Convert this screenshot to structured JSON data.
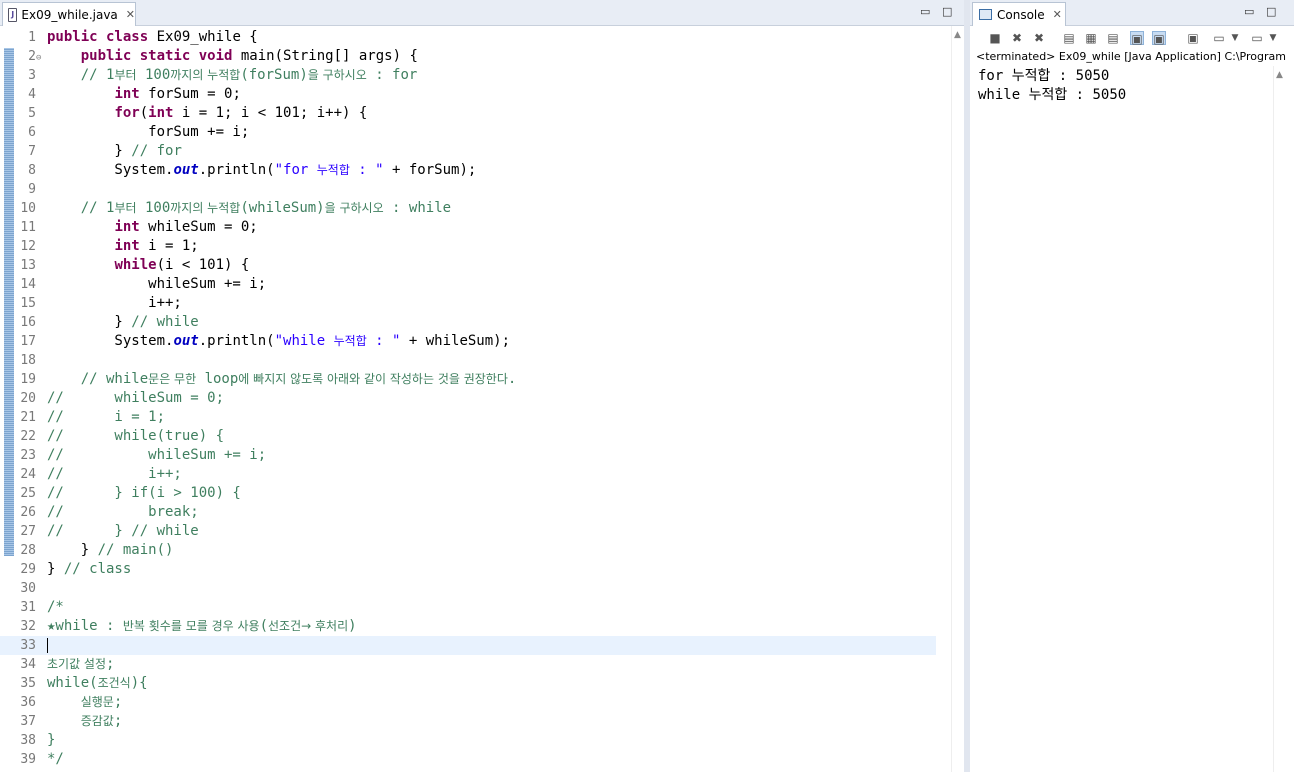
{
  "editor": {
    "tab_label": "Ex09_while.java",
    "lines": [
      {
        "n": "1",
        "html": "<span class='kw'>public class</span> Ex09_while {"
      },
      {
        "n": "2",
        "html": "    <span class='kw'>public static void</span> main(String[] args) {",
        "fold": "⊖"
      },
      {
        "n": "3",
        "html": "    <span class='cm'>// 1<span class='ko'>부터</span> 100<span class='ko'>까지의 누적합</span>(forSum)<span class='ko'>을 구하시오</span> : for</span>"
      },
      {
        "n": "4",
        "html": "        <span class='kw'>int</span> forSum = 0;"
      },
      {
        "n": "5",
        "html": "        <span class='kw'>for</span>(<span class='kw'>int</span> i = 1; i &lt; 101; i++) {"
      },
      {
        "n": "6",
        "html": "            forSum += i;"
      },
      {
        "n": "7",
        "html": "        } <span class='cm'>// for</span>"
      },
      {
        "n": "8",
        "html": "        System.<span class='fld'>out</span>.println(<span class='str'>\"for <span class='ko'>누적합</span> : \"</span> + forSum);"
      },
      {
        "n": "9",
        "html": ""
      },
      {
        "n": "10",
        "html": "    <span class='cm'>// 1<span class='ko'>부터</span> 100<span class='ko'>까지의 누적합</span>(whileSum)<span class='ko'>을 구하시오</span> : while</span>"
      },
      {
        "n": "11",
        "html": "        <span class='kw'>int</span> whileSum = 0;"
      },
      {
        "n": "12",
        "html": "        <span class='kw'>int</span> i = 1;"
      },
      {
        "n": "13",
        "html": "        <span class='kw'>while</span>(i &lt; 101) {"
      },
      {
        "n": "14",
        "html": "            whileSum += i;"
      },
      {
        "n": "15",
        "html": "            i++;"
      },
      {
        "n": "16",
        "html": "        } <span class='cm'>// while</span>"
      },
      {
        "n": "17",
        "html": "        System.<span class='fld'>out</span>.println(<span class='str'>\"while <span class='ko'>누적합</span> : \"</span> + whileSum);"
      },
      {
        "n": "18",
        "html": ""
      },
      {
        "n": "19",
        "html": "    <span class='cm'>// while<span class='ko'>문은 무한</span> loop<span class='ko'>에 빠지지 않도록 아래와 같이 작성하는 것을 권장한다</span>.</span>"
      },
      {
        "n": "20",
        "html": "<span class='cm'>//      whileSum = 0;</span>"
      },
      {
        "n": "21",
        "html": "<span class='cm'>//      i = 1;</span>"
      },
      {
        "n": "22",
        "html": "<span class='cm'>//      while(true) {</span>"
      },
      {
        "n": "23",
        "html": "<span class='cm'>//          whileSum += i;</span>"
      },
      {
        "n": "24",
        "html": "<span class='cm'>//          i++;</span>"
      },
      {
        "n": "25",
        "html": "<span class='cm'>//      } if(i &gt; 100) {</span>"
      },
      {
        "n": "26",
        "html": "<span class='cm'>//          break;</span>"
      },
      {
        "n": "27",
        "html": "<span class='cm'>//      } // while</span>"
      },
      {
        "n": "28",
        "html": "    } <span class='cm'>// main()</span>"
      },
      {
        "n": "29",
        "html": "} <span class='cm'>// class</span>"
      },
      {
        "n": "30",
        "html": ""
      },
      {
        "n": "31",
        "html": "<span class='cm'>/*</span>"
      },
      {
        "n": "32",
        "html": "<span class='cm'>★while : <span class='ko'>반복 횟수를 모를 경우 사용</span>(<span class='ko'>선조건→ 후처리</span>)</span>"
      },
      {
        "n": "33",
        "html": "",
        "current": true
      },
      {
        "n": "34",
        "html": "<span class='cm'><span class='ko'>초기값 설정</span>;</span>"
      },
      {
        "n": "35",
        "html": "<span class='cm'>while(<span class='ko'>조건식</span>){</span>"
      },
      {
        "n": "36",
        "html": "<span class='cm'>    <span class='ko'>실행문</span>;</span>"
      },
      {
        "n": "37",
        "html": "<span class='cm'>    <span class='ko'>증감값</span>;</span>"
      },
      {
        "n": "38",
        "html": "<span class='cm'>}</span>"
      },
      {
        "n": "39",
        "html": "<span class='cm'>*/</span>"
      }
    ]
  },
  "console": {
    "tab_label": "Console",
    "status": "<terminated> Ex09_while [Java Application] C:\\Program Files",
    "output": [
      "for 누적합 : 5050",
      "while 누적합 : 5050"
    ]
  },
  "icons": {
    "close": "✕",
    "minimize": "▭",
    "maximize": "□"
  }
}
